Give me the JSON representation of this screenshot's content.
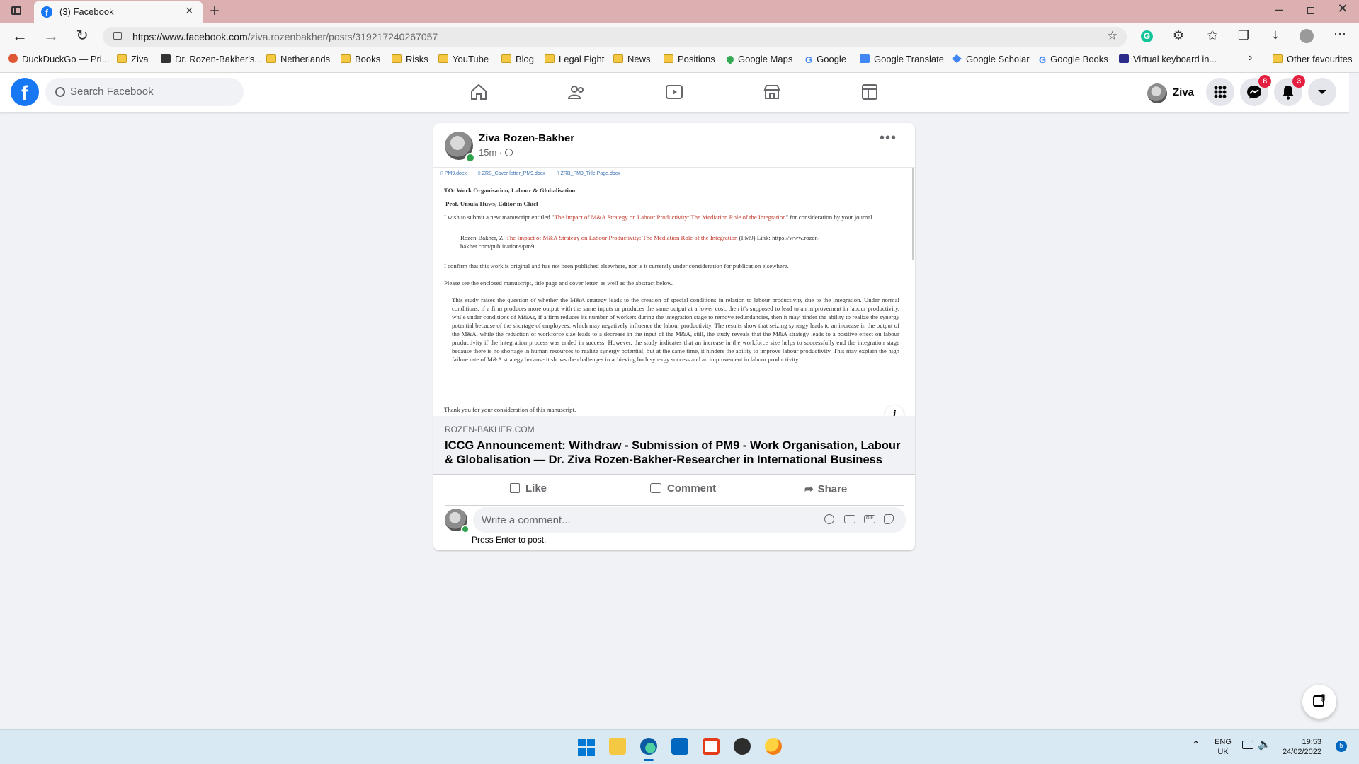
{
  "browser": {
    "tab_title": "(3) Facebook",
    "url_domain": "https://www.facebook.com",
    "url_path": "/ziva.rozenbakher/posts/319217240267057",
    "bookmarks": [
      {
        "label": "DuckDuckGo — Pri...",
        "icon": "duckduckgo-icon"
      },
      {
        "label": "Ziva",
        "icon": "folder-icon"
      },
      {
        "label": "Dr. Rozen-Bakher's...",
        "icon": "box-icon"
      },
      {
        "label": "Netherlands",
        "icon": "folder-icon"
      },
      {
        "label": "Books",
        "icon": "folder-icon"
      },
      {
        "label": "Risks",
        "icon": "folder-icon"
      },
      {
        "label": "YouTube",
        "icon": "folder-icon"
      },
      {
        "label": "Blog",
        "icon": "folder-icon"
      },
      {
        "label": "Legal Fight",
        "icon": "folder-icon"
      },
      {
        "label": "News",
        "icon": "folder-icon"
      },
      {
        "label": "Positions",
        "icon": "folder-icon"
      },
      {
        "label": "Google Maps",
        "icon": "map-pin-icon"
      },
      {
        "label": "Google",
        "icon": "google-icon"
      },
      {
        "label": "Google Translate",
        "icon": "translate-icon"
      },
      {
        "label": "Google Scholar",
        "icon": "scholar-icon"
      },
      {
        "label": "Google Books",
        "icon": "google-icon"
      },
      {
        "label": "Virtual keyboard in...",
        "icon": "keyboard-icon"
      }
    ],
    "other_favourites": "Other favourites"
  },
  "facebook": {
    "search_placeholder": "Search Facebook",
    "profile_name": "Ziva",
    "messenger_badge": "8",
    "notifications_badge": "3"
  },
  "post": {
    "author": "Ziva Rozen-Bakher",
    "time": "15m",
    "document": {
      "attachments": [
        "PM9.docx",
        "ZRB_Cover letter_PM9.docx",
        "ZRB_PM9_Title Page.docx"
      ],
      "to_line": "TO: Work Organisation, Labour & Globalisation",
      "editor_line": "Prof. Ursula Huws, Editor in Chief",
      "submit_pre": "I wish to submit a new manuscript entitled \"",
      "submit_title": "The Impact of M&A Strategy on Labour Productivity: The Mediation Role of the Integration",
      "submit_post": "\" for consideration by your journal.",
      "ref_pre": "Rozen-Bakher, Z. ",
      "ref_title": "The Impact of M&A Strategy on Labour Productivity: The Mediation Role of the Integration",
      "ref_post": " (PM9) Link: https://www.rozen-bakher.com/publications/pm9",
      "confirm": "I confirm that this work is original and has not been published elsewhere, nor is it currently under consideration for publication elsewhere.",
      "please_see": "Please see the enclosed manuscript, title page and cover letter, as well as the abstract below.",
      "abstract": "This study raises the question of whether the M&A strategy leads to the creation of special conditions in relation to labour productivity due to the integration. Under normal conditions, if a firm produces more output with the same inputs or produces the same output at a lower cost, then it's supposed to lead to an improvement in labour productivity, while under conditions of M&As, if a firm reduces its number of workers during the integration stage to remove redundancies, then it may hinder the ability to realize the synergy potential because of the shortage of employees, which may negatively influence the labour productivity. The results show that seizing synergy leads to an increase in the output of the M&A, while the reduction of workforce size leads to a decrease in the input of the M&A, still, the study reveals that the M&A strategy leads to a positive effect on labour productivity if the integration process was ended in success. However, the study indicates that an increase in the workforce size helps to successfully end the integration stage because there is no shortage in human resources to realize synergy potential, but at the same time, it hinders the ability to improve labour productivity. This may explain the high failure rate of M&A strategy because it shows the challenges in achieving both synergy success and an improvement in labour productivity.",
      "thanks": "Thank you for your consideration of this manuscript."
    },
    "link_domain": "ROZEN-BAKHER.COM",
    "link_title": "ICCG Announcement: Withdraw - Submission of PM9 - Work Organisation, Labour & Globalisation — Dr. Ziva Rozen-Bakher-Researcher in International Business wi...",
    "actions": {
      "like": "Like",
      "comment": "Comment",
      "share": "Share"
    },
    "comment_placeholder": "Write a comment...",
    "press_enter": "Press Enter to post."
  },
  "taskbar": {
    "lang": "ENG",
    "region": "UK",
    "time": "19:53",
    "date": "24/02/2022",
    "notif_count": "5"
  },
  "colors": {
    "fb_blue": "#1877f2",
    "badge_red": "#e41e3f",
    "link_red": "#c0392b",
    "tabbar": "#dcb0b0"
  }
}
